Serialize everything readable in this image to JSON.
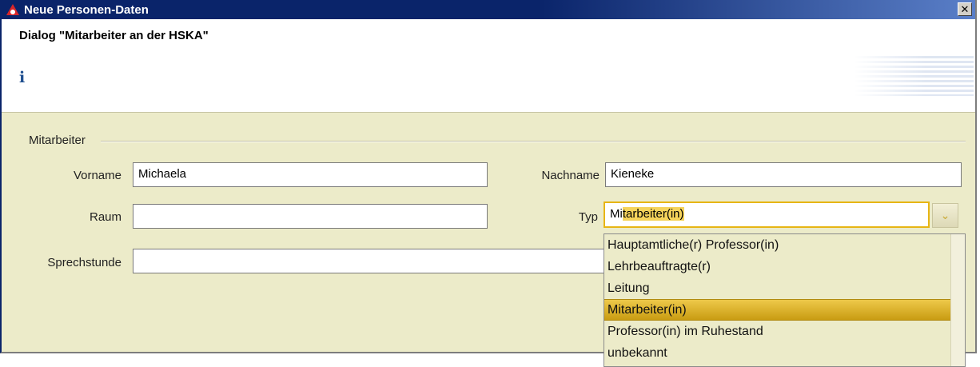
{
  "window": {
    "title": "Neue Personen-Daten",
    "close_glyph": "✕"
  },
  "header": {
    "dialog_title": "Dialog \"Mitarbeiter an der HSKA\"",
    "info_glyph": "i"
  },
  "group": {
    "label": "Mitarbeiter"
  },
  "form": {
    "vorname_label": "Vorname",
    "vorname_value": "Michaela",
    "nachname_label": "Nachname",
    "nachname_value": "Kieneke",
    "raum_label": "Raum",
    "raum_value": "",
    "typ_label": "Typ",
    "typ_typed": "Mi",
    "typ_completion": "tarbeiter(in)",
    "sprechstunde_label": "Sprechstunde",
    "sprechstunde_value": ""
  },
  "dropdown": {
    "arrow_glyph": "⌄",
    "items": [
      "Hauptamtliche(r) Professor(in)",
      "Lehrbeauftragte(r)",
      "Leitung",
      "Mitarbeiter(in)",
      "Professor(in) im Ruhestand",
      "unbekannt"
    ],
    "selected": "Mitarbeiter(in)"
  },
  "colors": {
    "titlebar": "#0a246a",
    "panel": "#ecebc9",
    "highlight": "#e7b514",
    "app_icon": "#d8262a"
  }
}
